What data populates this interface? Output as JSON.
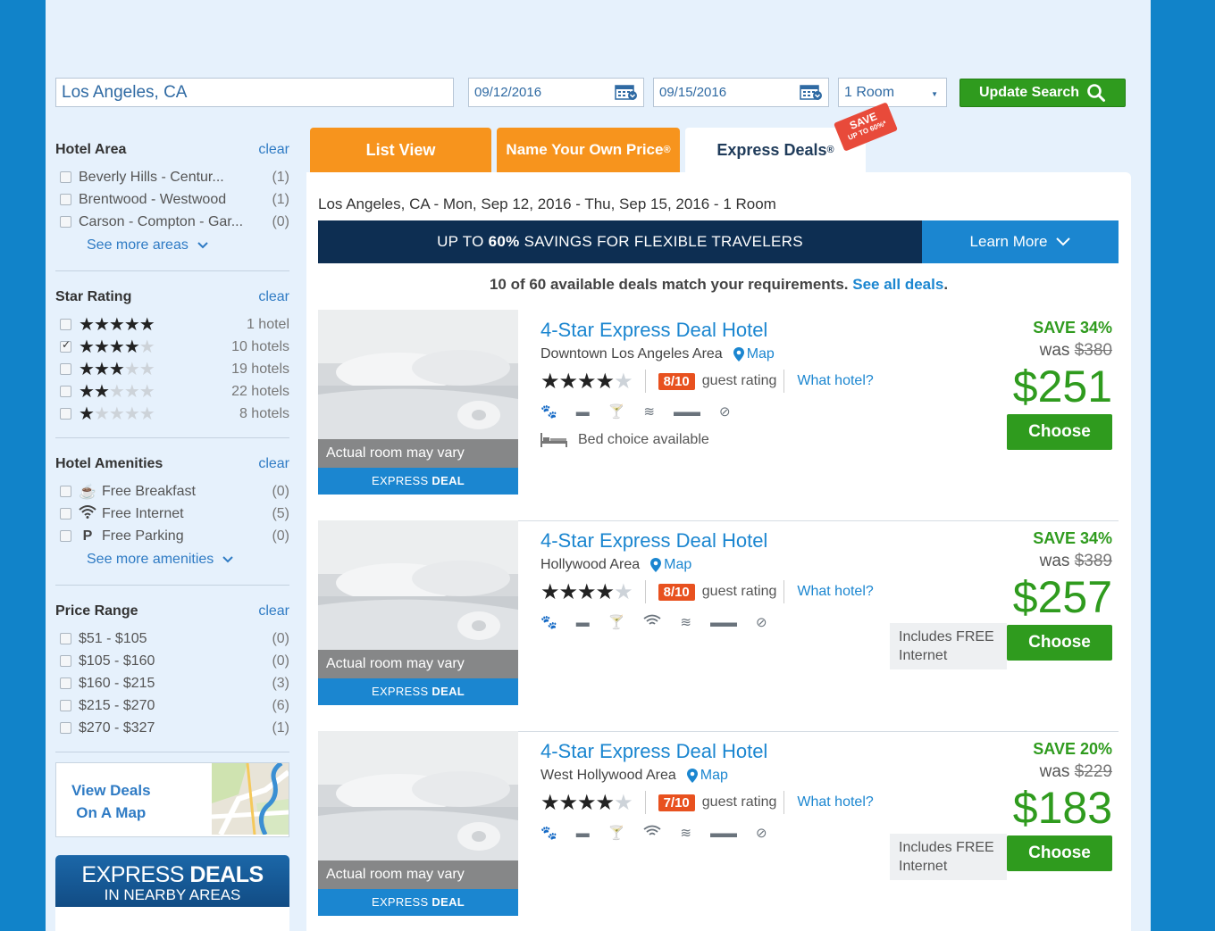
{
  "search": {
    "location": "Los Angeles, CA",
    "checkin": "09/12/2016",
    "checkout": "09/15/2016",
    "rooms": "1 Room",
    "update_label": "Update Search"
  },
  "filters": {
    "hotel_area": {
      "title": "Hotel Area",
      "clear": "clear",
      "items": [
        {
          "label": "Beverly Hills - Centur...",
          "count": "(1)"
        },
        {
          "label": "Brentwood - Westwood",
          "count": "(1)"
        },
        {
          "label": "Carson - Compton - Gar...",
          "count": "(0)"
        }
      ],
      "see_more": "See more areas"
    },
    "star_rating": {
      "title": "Star Rating",
      "clear": "clear",
      "items": [
        {
          "stars": 5,
          "count": "1 hotel",
          "checked": false
        },
        {
          "stars": 4,
          "count": "10 hotels",
          "checked": true
        },
        {
          "stars": 3,
          "count": "19 hotels",
          "checked": false
        },
        {
          "stars": 2,
          "count": "22 hotels",
          "checked": false
        },
        {
          "stars": 1,
          "count": "8 hotels",
          "checked": false
        }
      ]
    },
    "amenities": {
      "title": "Hotel Amenities",
      "clear": "clear",
      "items": [
        {
          "icon": "coffee-icon",
          "label": "Free Breakfast",
          "count": "(0)"
        },
        {
          "icon": "wifi-icon",
          "label": "Free Internet",
          "count": "(5)"
        },
        {
          "icon": "parking-icon",
          "label": "Free Parking",
          "count": "(0)"
        }
      ],
      "see_more": "See more amenities"
    },
    "price_range": {
      "title": "Price Range",
      "clear": "clear",
      "items": [
        {
          "label": "$51 - $105",
          "count": "(0)"
        },
        {
          "label": "$105 - $160",
          "count": "(0)"
        },
        {
          "label": "$160 - $215",
          "count": "(3)"
        },
        {
          "label": "$215 - $270",
          "count": "(6)"
        },
        {
          "label": "$270 - $327",
          "count": "(1)"
        }
      ]
    }
  },
  "map_box": {
    "line1": "View Deals",
    "line2": "On A Map"
  },
  "nearby": {
    "express": "EXPRESS",
    "deals": "DEALS",
    "sub": "IN NEARBY AREAS"
  },
  "tabs": {
    "list": "List View",
    "nyop": "Name Your Own Price",
    "express": "Express Deals",
    "reg": "®",
    "save_badge_1": "SAVE",
    "save_badge_2": "UP TO 60%*"
  },
  "summary": "Los Angeles, CA - Mon, Sep 12, 2016 - Thu, Sep 15, 2016 - 1 Room",
  "banner": {
    "pre": "UP TO",
    "pct": "60%",
    "post": "SAVINGS FOR FLEXIBLE TRAVELERS",
    "learn_more": "Learn More"
  },
  "match": {
    "text": "10 of 60 available deals match your requirements.",
    "link": "See all deals",
    "period": "."
  },
  "deal_common": {
    "room_vary": "Actual room may vary",
    "express": "EXPRESS",
    "deal": "DEAL",
    "guest_rating": "guest rating",
    "what_hotel": "What hotel?",
    "map": "Map",
    "choose": "Choose",
    "bed_choice": "Bed choice available"
  },
  "deals": [
    {
      "name": "4-Star Express Deal Hotel",
      "area": "Downtown Los Angeles Area",
      "stars": 4,
      "rating": "8/10",
      "save": "SAVE 34%",
      "was_label": "was",
      "was": "$380",
      "price": "$251",
      "free_internet": false,
      "bed_choice": true
    },
    {
      "name": "4-Star Express Deal Hotel",
      "area": "Hollywood Area",
      "stars": 4,
      "rating": "8/10",
      "save": "SAVE 34%",
      "was_label": "was",
      "was": "$389",
      "price": "$257",
      "free_internet": true,
      "free_line1": "Includes FREE",
      "free_line2": "Internet"
    },
    {
      "name": "4-Star Express Deal Hotel",
      "area": "West Hollywood Area",
      "stars": 4,
      "rating": "7/10",
      "save": "SAVE 20%",
      "was_label": "was",
      "was": "$229",
      "price": "$183",
      "free_internet": true,
      "free_line1": "Includes FREE",
      "free_line2": "Internet"
    }
  ],
  "colors": {
    "page_bg": "#1183c9",
    "green": "#2f9b1e",
    "orange": "#f7941d",
    "blue_link": "#1b86d0",
    "navy": "#0d2e52",
    "rating_badge": "#e8511f"
  }
}
